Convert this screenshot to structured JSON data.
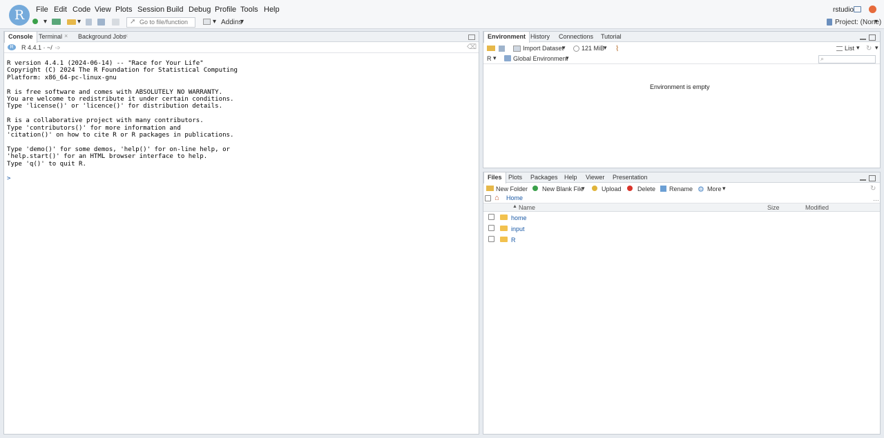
{
  "menu": [
    "File",
    "Edit",
    "Code",
    "View",
    "Plots",
    "Session",
    "Build",
    "Debug",
    "Profile",
    "Tools",
    "Help"
  ],
  "user": "rstudio",
  "toolbar": {
    "goto_placeholder": "Go to file/function",
    "addins": "Addins",
    "project": "Project: (None)"
  },
  "console": {
    "tabs": [
      "Console",
      "Terminal",
      "Background Jobs"
    ],
    "version_label": "R 4.4.1 · ~/",
    "output": "R version 4.4.1 (2024-06-14) -- \"Race for Your Life\"\nCopyright (C) 2024 The R Foundation for Statistical Computing\nPlatform: x86_64-pc-linux-gnu\n\nR is free software and comes with ABSOLUTELY NO WARRANTY.\nYou are welcome to redistribute it under certain conditions.\nType 'license()' or 'licence()' for distribution details.\n\nR is a collaborative project with many contributors.\nType 'contributors()' for more information and\n'citation()' on how to cite R or R packages in publications.\n\nType 'demo()' for some demos, 'help()' for on-line help, or\n'help.start()' for an HTML browser interface to help.\nType 'q()' to quit R.",
    "prompt": ">"
  },
  "environment": {
    "tabs": [
      "Environment",
      "History",
      "Connections",
      "Tutorial"
    ],
    "import_dataset": "Import Dataset",
    "memory": "121 MiB",
    "view_mode": "List",
    "language": "R",
    "scope": "Global Environment",
    "empty_message": "Environment is empty"
  },
  "files": {
    "tabs": [
      "Files",
      "Plots",
      "Packages",
      "Help",
      "Viewer",
      "Presentation"
    ],
    "actions": {
      "new_folder": "New Folder",
      "new_blank_file": "New Blank File",
      "upload": "Upload",
      "delete": "Delete",
      "rename": "Rename",
      "more": "More"
    },
    "breadcrumb": "Home",
    "columns": {
      "name": "Name",
      "size": "Size",
      "modified": "Modified"
    },
    "rows": [
      "home",
      "input",
      "R"
    ]
  },
  "colors": {
    "accent": "#75aadb",
    "link": "#1b5aa6"
  }
}
